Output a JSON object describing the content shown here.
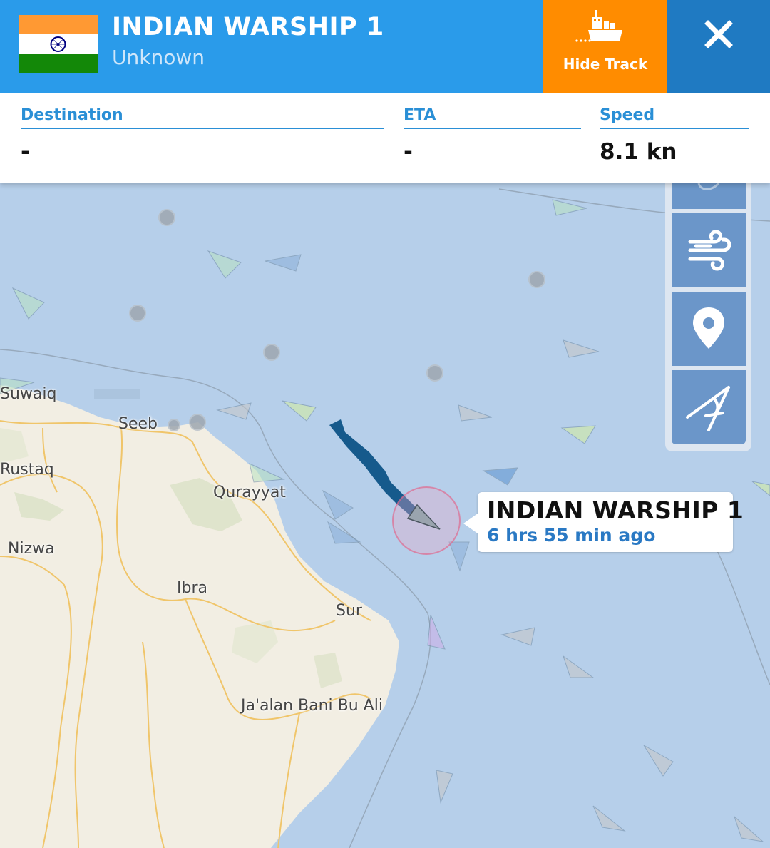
{
  "vessel": {
    "name": "INDIAN WARSHIP 1",
    "type": "Unknown",
    "flag_country": "India"
  },
  "header": {
    "hide_track_label": "Hide Track",
    "close_icon": "close-icon",
    "track_icon": "ship-icon"
  },
  "info": {
    "destination_label": "Destination",
    "destination_value": "-",
    "eta_label": "ETA",
    "eta_value": "-",
    "speed_label": "Speed",
    "speed_value": "8.1 kn"
  },
  "map_tools": [
    {
      "name": "layers-icon"
    },
    {
      "name": "wind-icon"
    },
    {
      "name": "location-pin-icon"
    },
    {
      "name": "measure-distance-icon"
    }
  ],
  "callout": {
    "title": "INDIAN WARSHIP 1",
    "time_ago": "6 hrs 55 min ago"
  },
  "places": {
    "suwaiq": "Suwaiq",
    "seeb": "Seeb",
    "rustaq": "Rustaq",
    "qurayyat": "Qurayyat",
    "nizwa": "Nizwa",
    "ibra": "Ibra",
    "sur": "Sur",
    "jaalan": "Ja'alan Bani Bu Ali"
  },
  "colors": {
    "header_blue": "#2a9bea",
    "hide_track_orange": "#ff8c00",
    "close_blue": "#1f7ac2",
    "sea": "#b6cfea",
    "land": "#f3efe4",
    "track": "#165a8c"
  }
}
